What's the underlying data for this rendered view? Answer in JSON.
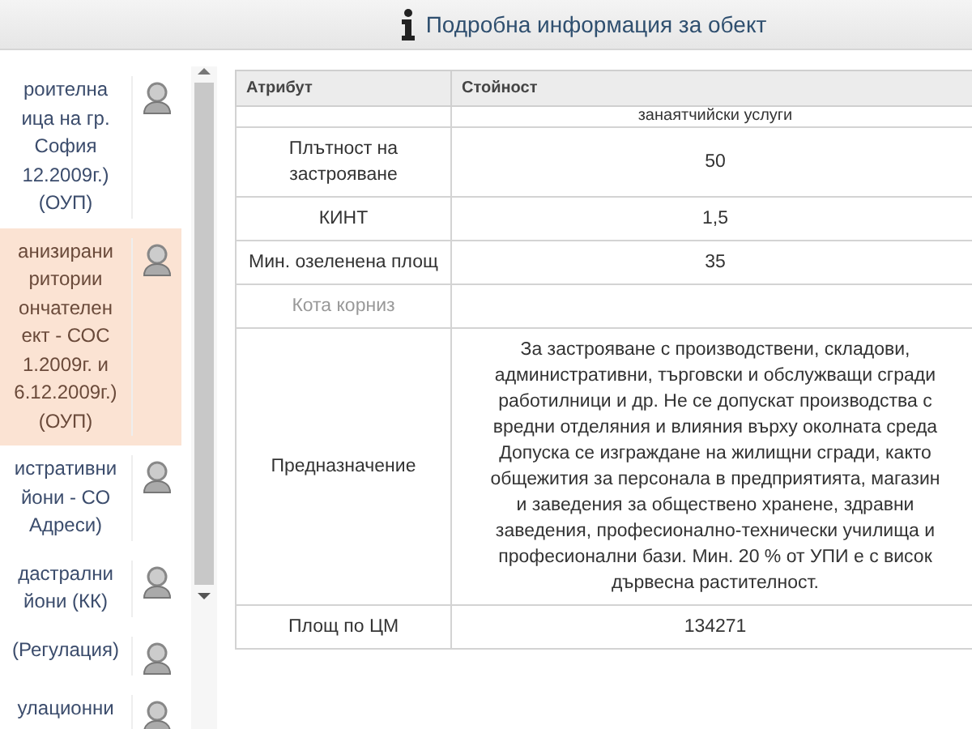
{
  "header": {
    "title": "Подробна информация за обект"
  },
  "layers": [
    {
      "lines": [
        "роителна",
        "ица на гр.",
        "София",
        "12.2009г.)",
        "(ОУП)"
      ],
      "selected": false
    },
    {
      "lines": [
        "анизирани",
        "ритории",
        "ончателен",
        "ект - СОС",
        "1.2009г. и",
        "6.12.2009г.)",
        "(ОУП)"
      ],
      "selected": true
    },
    {
      "lines": [
        "истративни",
        "йони - СО",
        "Адреси)"
      ],
      "selected": false
    },
    {
      "lines": [
        "дастрални",
        "йони (КК)"
      ],
      "selected": false
    },
    {
      "lines": [
        "(Регулация)"
      ],
      "selected": false
    },
    {
      "lines": [
        "улационни"
      ],
      "selected": false
    }
  ],
  "table": {
    "columns": [
      "Атрибут",
      "Стойност"
    ],
    "rows": [
      {
        "value": [
          "занаятчийски услуги"
        ],
        "kind": "clipped"
      },
      {
        "attribute": "Плътност на застрояване",
        "value": [
          "50"
        ],
        "disabled": false,
        "kind": "normal"
      },
      {
        "attribute": "КИНТ",
        "value": [
          "1,5"
        ],
        "disabled": false,
        "kind": "normal"
      },
      {
        "attribute": "Мин. озеленена площ",
        "value": [
          "35"
        ],
        "disabled": false,
        "kind": "normal"
      },
      {
        "attribute": "Кота корниз",
        "value": [],
        "disabled": true,
        "kind": "normal"
      },
      {
        "attribute": "Предназначение",
        "value": [
          "За застрояване с производствени, складови,",
          "административни, търговски и обслужващи сгради",
          "работилници и др. Не се допускат производства с",
          "вредни отделяния и влияния върху околната среда",
          "Допуска се изграждане на жилищни сгради, както",
          "общежития за персонала в предприятията, магазин",
          "и заведения за обществено хранене, здравни",
          "заведения, професионално-технически училища и",
          "професионални бази. Мин. 20 % от УПИ е с висок",
          "дървесна растителност."
        ],
        "disabled": false,
        "kind": "normal"
      },
      {
        "attribute": "Площ по ЦМ",
        "value": [
          "134271"
        ],
        "disabled": false,
        "kind": "normal"
      }
    ]
  }
}
